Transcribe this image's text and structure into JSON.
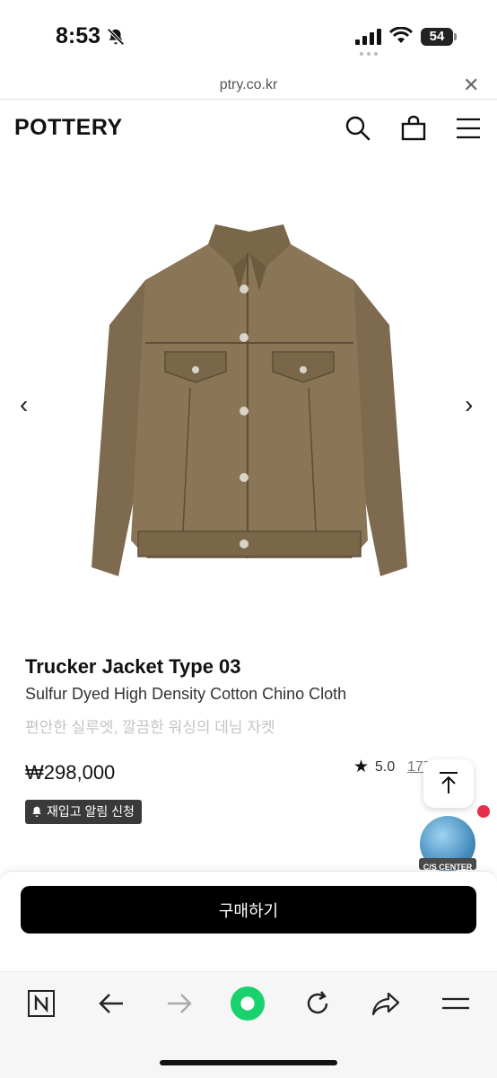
{
  "status_bar": {
    "time": "8:53",
    "battery": "54"
  },
  "browser": {
    "url": "ptry.co.kr"
  },
  "site": {
    "logo": "POTTERY"
  },
  "product": {
    "name": "Trucker Jacket Type 03",
    "subtitle": "Sulfur Dyed High Density Cotton Chino Cloth",
    "description": "편안한 실루엣, 깔끔한 워싱의 데님 자켓",
    "price": "₩298,000",
    "rating": "5.0",
    "review_count": "177",
    "restock_label": "재입고 알림 신청",
    "buy_label": "구매하기"
  },
  "carousel": {
    "prev": "‹",
    "next": "›"
  },
  "cs_center": {
    "label": "C/S CENTER"
  },
  "colors": {
    "accent": "#000000",
    "notification": "#e8304a",
    "green": "#19d26e",
    "cs_blue": "#5aa8d8"
  },
  "icons": [
    "bell-off-icon",
    "signal-icon",
    "wifi-icon",
    "search-icon",
    "bag-icon",
    "menu-icon",
    "chevron-left-icon",
    "chevron-right-icon",
    "star-icon",
    "bell-icon",
    "scroll-top-icon",
    "naver-icon",
    "back-arrow-icon",
    "forward-arrow-icon",
    "green-dot-icon",
    "reload-icon",
    "share-icon",
    "hamburger-icon"
  ]
}
